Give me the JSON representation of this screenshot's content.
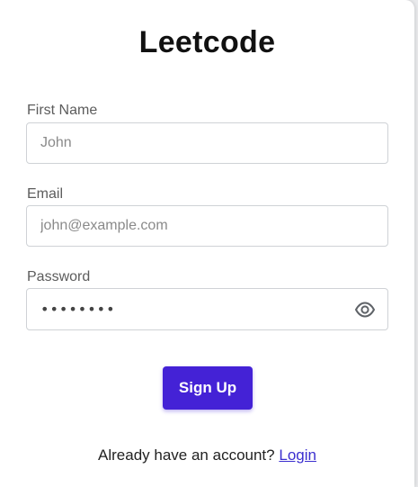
{
  "header": {
    "title": "Leetcode"
  },
  "form": {
    "first_name": {
      "label": "First Name",
      "placeholder": "John"
    },
    "email": {
      "label": "Email",
      "placeholder": "john@example.com"
    },
    "password": {
      "label": "Password",
      "value": "••••••••",
      "toggle_icon": "eye-icon"
    },
    "submit_label": "Sign Up",
    "accent_color": "#4422d6"
  },
  "footer": {
    "prompt": "Already have an account?",
    "login_link": "Login"
  }
}
